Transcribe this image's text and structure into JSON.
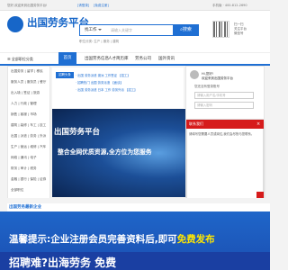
{
  "topbar": {
    "welcome": "您好,欢迎来到出国劳务平台!",
    "login": "[请登录]",
    "register": "[免费注册]",
    "right": "手机版  ·  400-812-2690"
  },
  "header": {
    "logo_text": "出国劳务平台",
    "search_type": "找工作",
    "search_placeholder": "请输入关键字",
    "search_button": "搜索",
    "hot_label": "职位分类: 生产 | 服务 | 建筑",
    "qr_caption": "扫一扫\n关注平台\n微信号"
  },
  "nav": {
    "category_header": "全部职位分类",
    "items": [
      "首页",
      "出国劳务信息",
      "人才简历库",
      "劳务公司",
      "国外资讯"
    ]
  },
  "sidebar": {
    "items": [
      "出国劳务 | 留学 | 移民",
      "服务人员 | 服务员 | 餐厅",
      "出入境 | 签证 | 旅游",
      "人力 | 行政 | 管理",
      "销售 | 客服 | 市场",
      "建筑 | 装修 | 车工 | 技工",
      "出国 | 派遣 | 劳务 | 外派",
      "生产 | 营运 | 维修 | 汽车",
      "网络 | 通讯 | 电子",
      "财务 | 审计 | 税务",
      "金融 | 银行 | 保险 | 证券",
      "全部职位"
    ]
  },
  "headlines": {
    "tag": "招聘头条",
    "lines": [
      "· 出国 劳务派遣 澳洲 工作签证 【招工】",
      "· 招聘热门 出国 劳务派遣 【面谈】",
      "· 出国 劳务派遣 日本 工作 劳务外派 【招工】"
    ]
  },
  "banner": {
    "title": "出国劳务平台",
    "subtitle": "整合全网优质资源,全方位为您服务"
  },
  "login_panel": {
    "hello": "Hi,您好!\n欢迎来到出国劳务平台",
    "guest_note": "您还没有登录账号",
    "username_placeholder": "请输入用户名/手机号",
    "password_placeholder": "请输入密码"
  },
  "popup": {
    "title": "联系我们",
    "close": "×",
    "body": "请填写您需要人员或岗位,我们会尽快与您联系。"
  },
  "section": {
    "title": "出国劳务最新企业"
  },
  "ad": {
    "text_main": "温馨提示:企业注册会员完善资料后,即可",
    "text_highlight": "免费发布",
    "text2": "招聘难?出海劳务 免费"
  }
}
